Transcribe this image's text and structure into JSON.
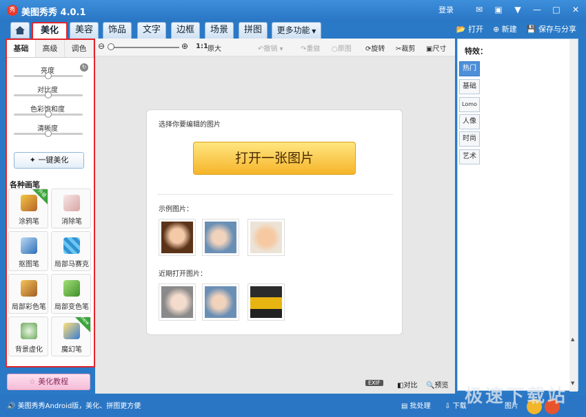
{
  "window": {
    "title": "美图秀秀 4.0.1",
    "logo_text": "秀",
    "login": "登录"
  },
  "nav": {
    "tabs": [
      "美化",
      "美容",
      "饰品",
      "文字",
      "边框",
      "场景",
      "拼图",
      "更多功能"
    ],
    "open": "打开",
    "new": "新建",
    "save": "保存与分享"
  },
  "left": {
    "subtabs": [
      "基础",
      "高级",
      "调色"
    ],
    "sliders": [
      "亮度",
      "对比度",
      "色彩饱和度",
      "清晰度"
    ],
    "onekey": "一键美化",
    "brush_title": "各种画笔",
    "brushes": [
      {
        "label": "涂鸦笔",
        "icon": "pencil-icon",
        "badge": "升级"
      },
      {
        "label": "消除笔",
        "icon": "eraser-icon",
        "badge": ""
      },
      {
        "label": "抠图笔",
        "icon": "pen-nib-icon",
        "badge": ""
      },
      {
        "label": "局部马赛克",
        "icon": "mosaic-icon",
        "badge": ""
      },
      {
        "label": "局部彩色笔",
        "icon": "brush-icon",
        "badge": ""
      },
      {
        "label": "局部变色笔",
        "icon": "paint-bucket-icon",
        "badge": ""
      },
      {
        "label": "背景虚化",
        "icon": "blur-icon",
        "badge": ""
      },
      {
        "label": "魔幻笔",
        "icon": "magic-wand-icon",
        "badge": "new"
      }
    ],
    "tutorial": "美化教程"
  },
  "toolbar": {
    "zoom_1to1": "1:1",
    "zoom_original": "原大",
    "undo": "撤销",
    "redo": "重做",
    "original": "原图",
    "rotate": "旋转",
    "crop": "裁剪",
    "size": "尺寸"
  },
  "card": {
    "hint": "选择你要编辑的图片",
    "open_button": "打开一张图片",
    "samples_label": "示例图片：",
    "recent_label": "近期打开图片："
  },
  "canvas_bottom": {
    "exif": "EXIF",
    "compare": "对比",
    "preview": "预览"
  },
  "effects": {
    "title": "特效：",
    "tabs": [
      "热门",
      "基础",
      "Lomo",
      "人像",
      "时尚",
      "艺术"
    ]
  },
  "status": {
    "message": "美图秀秀Android版，美化、拼图更方便",
    "batch": "批处理",
    "download": "下载",
    "pictures": "图片"
  },
  "watermark": "极速下载站",
  "colors": {
    "accent": "#2a76c5",
    "highlight": "#e2252b",
    "open_button": "#f6b42a"
  }
}
